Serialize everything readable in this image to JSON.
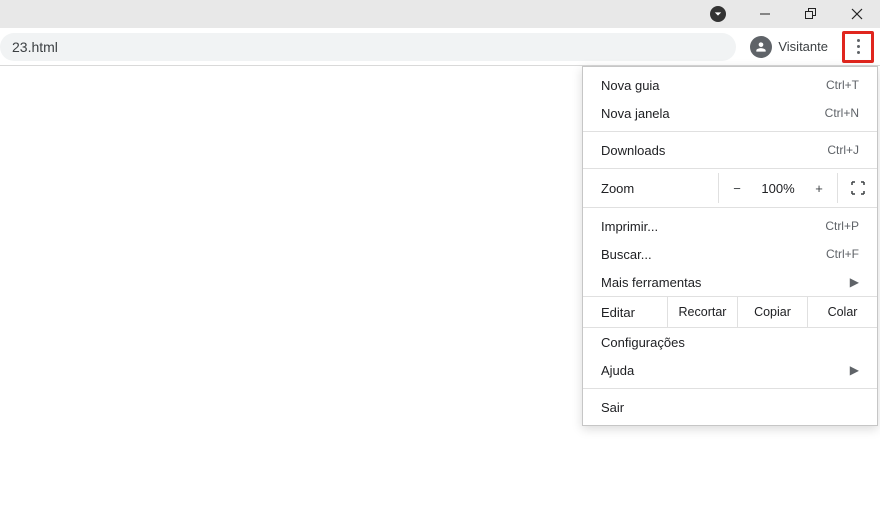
{
  "omnibox": {
    "url": "23.html"
  },
  "profile": {
    "label": "Visitante"
  },
  "menu": {
    "new_tab": {
      "label": "Nova guia",
      "shortcut": "Ctrl+T"
    },
    "new_window": {
      "label": "Nova janela",
      "shortcut": "Ctrl+N"
    },
    "downloads": {
      "label": "Downloads",
      "shortcut": "Ctrl+J"
    },
    "zoom": {
      "label": "Zoom",
      "value": "100%"
    },
    "print": {
      "label": "Imprimir...",
      "shortcut": "Ctrl+P"
    },
    "find": {
      "label": "Buscar...",
      "shortcut": "Ctrl+F"
    },
    "more_tools": {
      "label": "Mais ferramentas"
    },
    "edit": {
      "label": "Editar",
      "cut": "Recortar",
      "copy": "Copiar",
      "paste": "Colar"
    },
    "settings": {
      "label": "Configurações"
    },
    "help": {
      "label": "Ajuda"
    },
    "exit": {
      "label": "Sair"
    }
  }
}
